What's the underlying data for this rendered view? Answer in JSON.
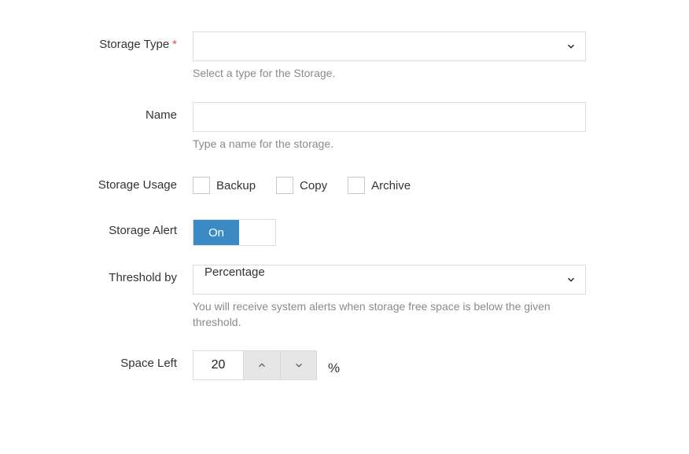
{
  "storageType": {
    "label": "Storage Type",
    "required_marker": "*",
    "value": "",
    "hint": "Select a type for the Storage."
  },
  "name": {
    "label": "Name",
    "value": "",
    "hint": "Type a name for the storage."
  },
  "storageUsage": {
    "label": "Storage Usage",
    "options": {
      "backup": "Backup",
      "copy": "Copy",
      "archive": "Archive"
    }
  },
  "storageAlert": {
    "label": "Storage Alert",
    "on_label": "On"
  },
  "thresholdBy": {
    "label": "Threshold by",
    "value": "Percentage",
    "hint": "You will receive system alerts when storage free space is below the given threshold."
  },
  "spaceLeft": {
    "label": "Space Left",
    "value": "20",
    "unit": "%"
  }
}
